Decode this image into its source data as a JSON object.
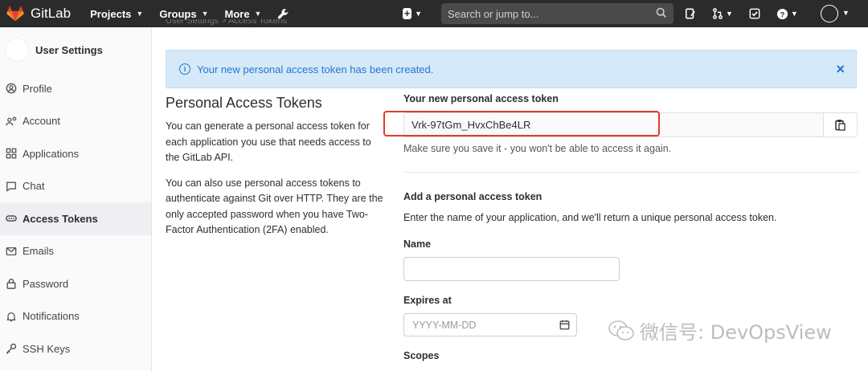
{
  "navbar": {
    "brand": "GitLab",
    "links": [
      {
        "label": "Projects"
      },
      {
        "label": "Groups"
      },
      {
        "label": "More"
      }
    ],
    "search_placeholder": "Search or jump to..."
  },
  "breadcrumb": "User Settings  >  Access Tokens",
  "sidebar": {
    "title": "User Settings",
    "items": [
      {
        "label": "Profile",
        "icon": "profile-icon"
      },
      {
        "label": "Account",
        "icon": "account-icon"
      },
      {
        "label": "Applications",
        "icon": "applications-icon"
      },
      {
        "label": "Chat",
        "icon": "chat-icon"
      },
      {
        "label": "Access Tokens",
        "icon": "token-icon",
        "active": true
      },
      {
        "label": "Emails",
        "icon": "email-icon"
      },
      {
        "label": "Password",
        "icon": "lock-icon"
      },
      {
        "label": "Notifications",
        "icon": "bell-icon"
      },
      {
        "label": "SSH Keys",
        "icon": "key-icon"
      }
    ]
  },
  "alert": {
    "message": "Your new personal access token has been created."
  },
  "left": {
    "heading": "Personal Access Tokens",
    "para1": "You can generate a personal access token for each application you use that needs access to the GitLab API.",
    "para2": "You can also use personal access tokens to authenticate against Git over HTTP. They are the only accepted password when you have Two-Factor Authentication (2FA) enabled."
  },
  "token": {
    "label": "Your new personal access token",
    "value": "Vrk-97tGm_HvxChBe4LR",
    "hint": "Make sure you save it - you won't be able to access it again."
  },
  "form": {
    "title": "Add a personal access token",
    "description": "Enter the name of your application, and we'll return a unique personal access token.",
    "name_label": "Name",
    "name_value": "",
    "expires_label": "Expires at",
    "expires_placeholder": "YYYY-MM-DD",
    "scopes_label": "Scopes"
  },
  "watermark": "微信号: DevOpsView",
  "colors": {
    "navbar": "#2b2b2b",
    "alert_bg": "#d5e9f8",
    "alert_text": "#1f78d1",
    "highlight": "#e23b2b"
  }
}
